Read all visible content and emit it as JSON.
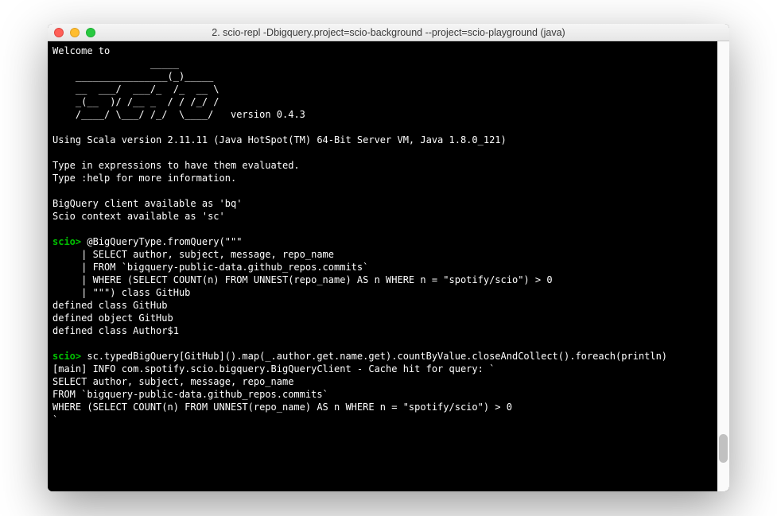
{
  "window": {
    "title": "2. scio-repl -Dbigquery.project=scio-background --project=scio-playground  (java)"
  },
  "terminal": {
    "welcome": "Welcome to",
    "ascii_art": [
      "                 _____",
      "    ________________(_)_____",
      "    __  ___/  ___/_  /_  __ \\",
      "    _(__  )/ /__ _  / / /_/ /",
      "    /____/ \\___/ /_/  \\____/"
    ],
    "version_label": "   version 0.4.3",
    "scala_version": "Using Scala version 2.11.11 (Java HotSpot(TM) 64-Bit Server VM, Java 1.8.0_121)",
    "instructions1": "Type in expressions to have them evaluated.",
    "instructions2": "Type :help for more information.",
    "bq_available": "BigQuery client available as 'bq'",
    "sc_available": "Scio context available as 'sc'",
    "prompt": "scio>",
    "cmd1_l1": " @BigQueryType.fromQuery(\"\"\"",
    "cmd1_l2": "     | SELECT author, subject, message, repo_name",
    "cmd1_l3": "     | FROM `bigquery-public-data.github_repos.commits`",
    "cmd1_l4": "     | WHERE (SELECT COUNT(n) FROM UNNEST(repo_name) AS n WHERE n = \"spotify/scio\") > 0",
    "cmd1_l5": "     | \"\"\") class GitHub",
    "out1": "defined class GitHub",
    "out2": "defined object GitHub",
    "out3": "defined class Author$1",
    "cmd2": " sc.typedBigQuery[GitHub]().map(_.author.get.name.get).countByValue.closeAndCollect().foreach(println)",
    "log1": "[main] INFO com.spotify.scio.bigquery.BigQueryClient - Cache hit for query: `",
    "log2": "SELECT author, subject, message, repo_name",
    "log3": "FROM `bigquery-public-data.github_repos.commits`",
    "log4": "WHERE (SELECT COUNT(n) FROM UNNEST(repo_name) AS n WHERE n = \"spotify/scio\") > 0",
    "log5": "`"
  }
}
